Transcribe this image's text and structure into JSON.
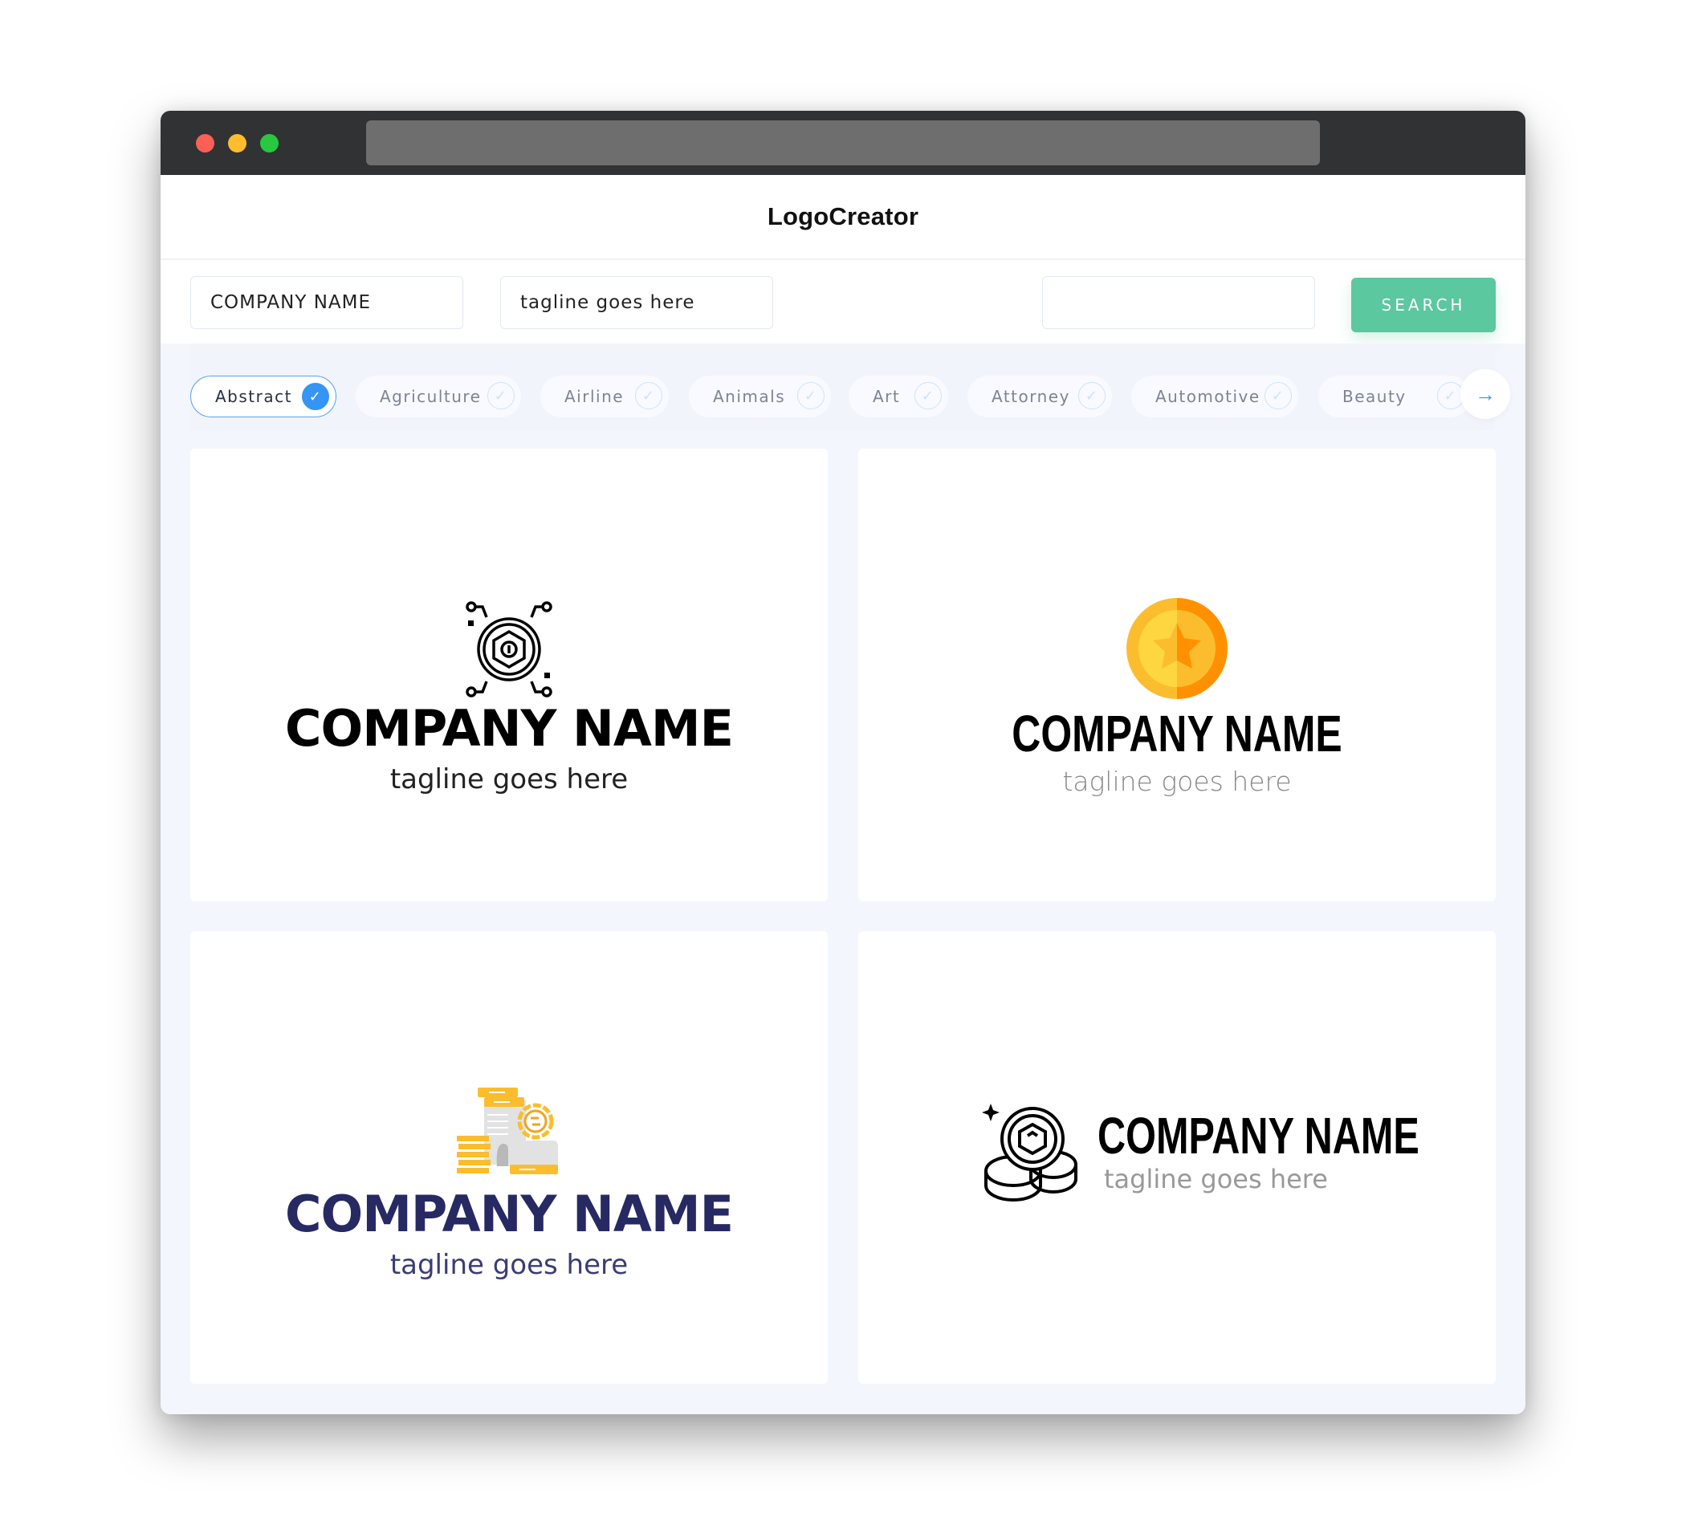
{
  "browser": {
    "traffic_lights": [
      "close",
      "minimize",
      "maximize"
    ],
    "url": ""
  },
  "header": {
    "title": "LogoCreator"
  },
  "search": {
    "company_name_value": "COMPANY NAME",
    "tagline_value": "tagline goes here",
    "keyword_value": "",
    "button_label": "SEARCH"
  },
  "filters": {
    "items": [
      {
        "label": "Abstract",
        "selected": true
      },
      {
        "label": "Agriculture",
        "selected": false
      },
      {
        "label": "Airline",
        "selected": false
      },
      {
        "label": "Animals",
        "selected": false
      },
      {
        "label": "Art",
        "selected": false
      },
      {
        "label": "Attorney",
        "selected": false
      },
      {
        "label": "Automotive",
        "selected": false
      },
      {
        "label": "Beauty",
        "selected": false
      }
    ],
    "next_icon": "arrow-right-icon"
  },
  "logos": [
    {
      "company": "COMPANY NAME",
      "tagline": "tagline goes here",
      "icon": "crypto-node-coin-icon",
      "name_color": "#000000"
    },
    {
      "company": "COMPANY NAME",
      "tagline": "tagline goes here",
      "icon": "star-coin-icon",
      "name_color": "#000000"
    },
    {
      "company": "COMPANY NAME",
      "tagline": "tagline goes here",
      "icon": "document-coins-icon",
      "name_color": "#272963"
    },
    {
      "company": "COMPANY NAME",
      "tagline": "tagline goes here",
      "icon": "coin-stack-icon",
      "name_color": "#000000"
    }
  ],
  "colors": {
    "accent_green": "#5bc89f",
    "accent_blue": "#3595f5",
    "titlebar": "#313234",
    "coin_yellow": "#fbbd2e",
    "coin_orange": "#ff9100",
    "navy": "#272963"
  }
}
